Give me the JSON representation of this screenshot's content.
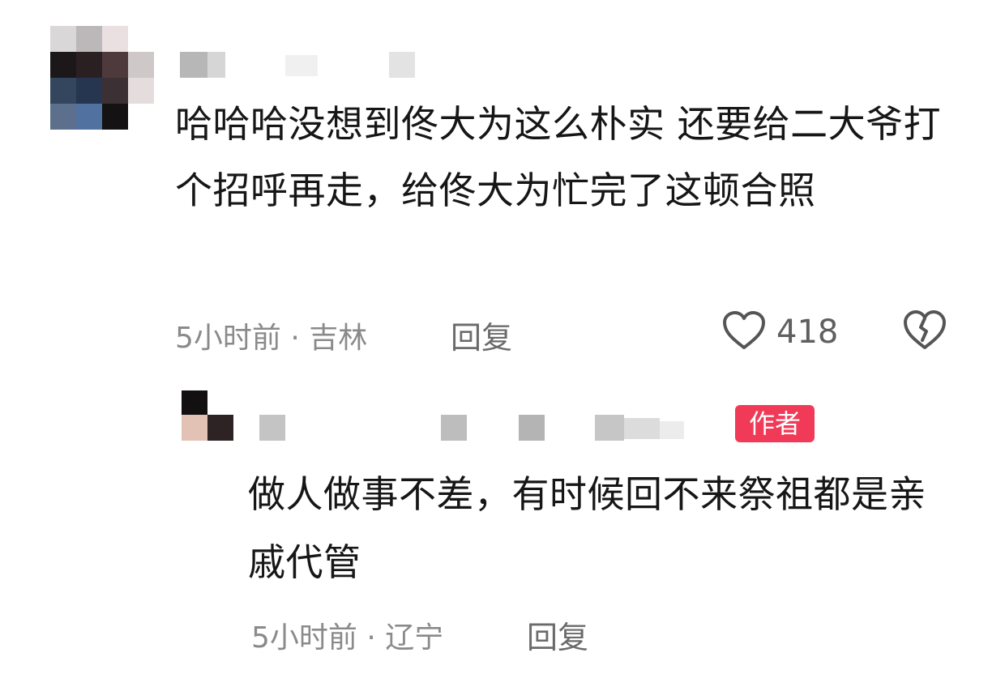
{
  "comment": {
    "text": "哈哈哈没想到佟大为这么朴实 还要给二大爷打个招呼再走，给佟大为忙完了这顿合照",
    "time_location": "5小时前 · 吉林",
    "reply_label": "回复",
    "like_count": "418"
  },
  "reply": {
    "badge": "作者",
    "text": "做人做事不差，有时候回不来祭祖都是亲戚代管",
    "time_location": "5小时前 · 辽宁",
    "reply_label": "回复"
  },
  "icons": {
    "like": "heart-outline-icon",
    "dislike": "broken-heart-icon"
  },
  "colors": {
    "author_badge": "#f03a58",
    "meta_text": "#8a8a8a",
    "body_text": "#161616"
  }
}
